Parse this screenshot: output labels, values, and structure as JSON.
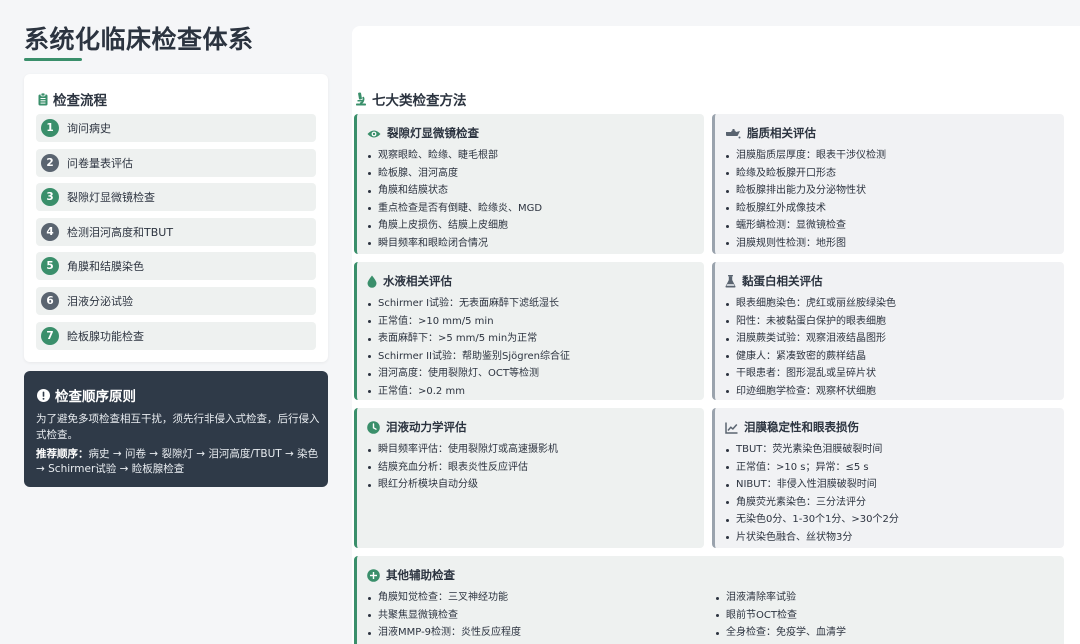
{
  "page_title": "系统化临床检查体系",
  "flow": {
    "heading": "检查流程",
    "steps": [
      {
        "num": "1",
        "label": "询问病史",
        "color": "#3a8f6b"
      },
      {
        "num": "2",
        "label": "问卷量表评估",
        "color": "#5a6470"
      },
      {
        "num": "3",
        "label": "裂隙灯显微镜检查",
        "color": "#3a8f6b"
      },
      {
        "num": "4",
        "label": "检测泪河高度和TBUT",
        "color": "#5a6470"
      },
      {
        "num": "5",
        "label": "角膜和结膜染色",
        "color": "#3a8f6b"
      },
      {
        "num": "6",
        "label": "泪液分泌试验",
        "color": "#5a6470"
      },
      {
        "num": "7",
        "label": "睑板腺功能检查",
        "color": "#3a8f6b"
      }
    ]
  },
  "principle": {
    "title": "检查顺序原则",
    "body": "为了避免多项检查相互干扰，须先行非侵入式检查，后行侵入式检查。",
    "order_label": "推荐顺序：",
    "order_text": "病史 → 问卷 → 裂隙灯 → 泪河高度/TBUT → 染色 → Schirmer试验 → 睑板腺检查"
  },
  "methods": {
    "heading": "七大类检查方法",
    "cards": [
      {
        "title": "裂隙灯显微镜检查",
        "icon": "eye-icon",
        "items": [
          "观察眼睑、睑缘、睫毛根部",
          "睑板腺、泪河高度",
          "角膜和结膜状态",
          "重点检查是否有倒睫、睑缘炎、MGD",
          "角膜上皮损伤、结膜上皮细胞",
          "瞬目频率和眼睑闭合情况"
        ]
      },
      {
        "title": "脂质相关评估",
        "icon": "oil-can-icon",
        "items": [
          "泪膜脂质层厚度：眼表干涉仪检测",
          "睑缘及睑板腺开口形态",
          "睑板腺排出能力及分泌物性状",
          "睑板腺红外成像技术",
          "蠕形螨检测：显微镜检查",
          "泪膜规则性检测：地形图"
        ]
      },
      {
        "title": "水液相关评估",
        "icon": "droplet-icon",
        "items": [
          "Schirmer I试验：无表面麻醉下滤纸湿长",
          "正常值：>10 mm/5 min",
          "表面麻醉下：>5 mm/5 min为正常",
          "Schirmer II试验：帮助鉴别Sjögren综合征",
          "泪河高度：使用裂隙灯、OCT等检测",
          "正常值：>0.2 mm"
        ]
      },
      {
        "title": "黏蛋白相关评估",
        "icon": "flask-icon",
        "items": [
          "眼表细胞染色：虎红或丽丝胺绿染色",
          "阳性：未被黏蛋白保护的眼表细胞",
          "泪膜蕨类试验：观察泪液结晶图形",
          "健康人：紧凑致密的蕨样结晶",
          "干眼患者：图形混乱或呈碎片状",
          "印迹细胞学检查：观察杯状细胞"
        ]
      },
      {
        "title": "泪液动力学评估",
        "icon": "clock-icon",
        "items": [
          "瞬目频率评估：使用裂隙灯或高速摄影机",
          "结膜充血分析：眼表炎性反应评估",
          "眼红分析模块自动分级"
        ]
      },
      {
        "title": "泪膜稳定性和眼表损伤",
        "icon": "chart-line-icon",
        "items": [
          "TBUT：荧光素染色泪膜破裂时间",
          "正常值：>10 s；异常：≤5 s",
          "NIBUT：非侵入性泪膜破裂时间",
          "角膜荧光素染色：三分法评分",
          "无染色0分、1-30个1分、>30个2分",
          "片状染色融合、丝状物3分"
        ]
      },
      {
        "title": "其他辅助检查",
        "icon": "plus-circle-icon",
        "items_left": [
          "角膜知觉检查：三叉神经功能",
          "共聚焦显微镜检查",
          "泪液MMP-9检测：炎性反应程度"
        ],
        "items_right": [
          "泪液清除率试验",
          "眼前节OCT检查",
          "全身检查：免疫学、血清学"
        ]
      }
    ]
  }
}
